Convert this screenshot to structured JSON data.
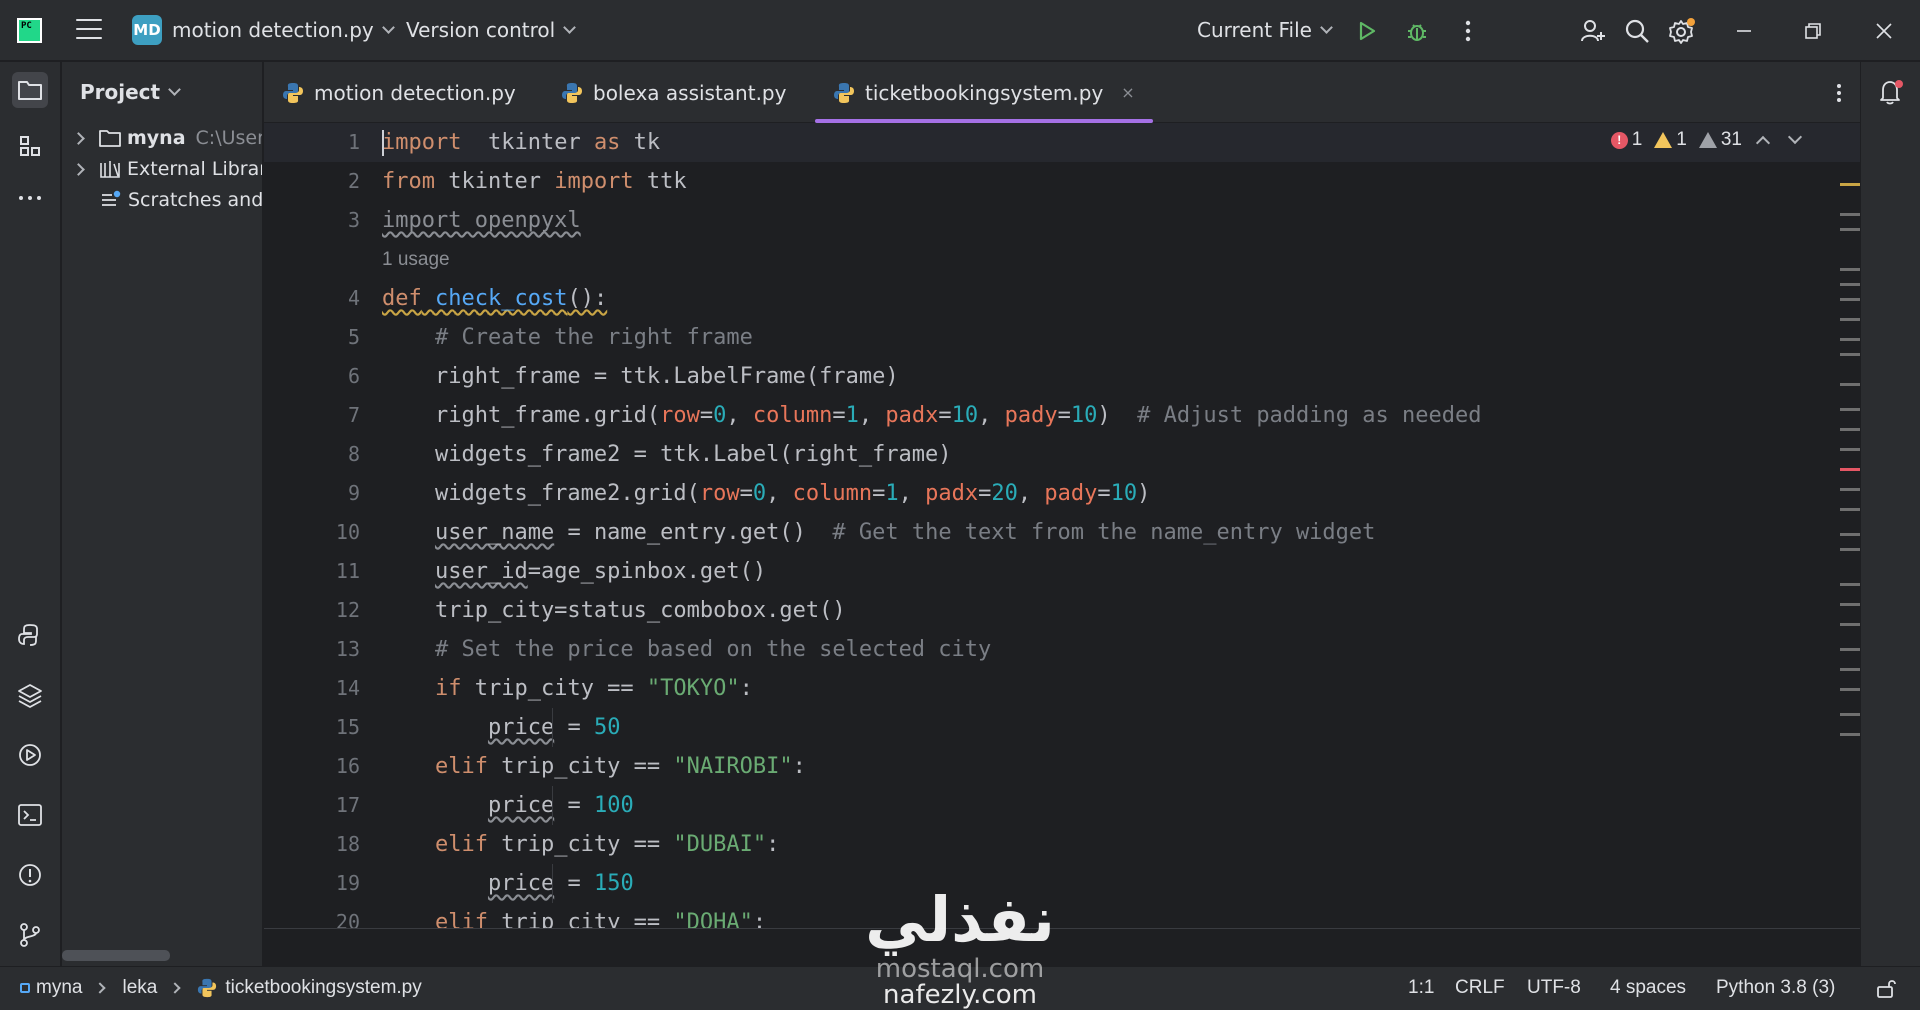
{
  "titlebar": {
    "logo_text": "PC",
    "project_badge": "MD",
    "project_name": "motion detection.py",
    "vcs_label": "Version control",
    "run_config": "Current File"
  },
  "project_panel": {
    "title": "Project",
    "items": [
      {
        "label": "myna",
        "hint": "C:\\Users"
      },
      {
        "label": "External Librari"
      },
      {
        "label": "Scratches and"
      }
    ]
  },
  "tabs": [
    {
      "label": "motion detection.py"
    },
    {
      "label": "bolexa assistant.py"
    },
    {
      "label": "ticketbookingsystem.py",
      "close": "×"
    }
  ],
  "inspections": {
    "errors": "1",
    "warnings": "1",
    "weak_warnings": "31"
  },
  "editor": {
    "usage_hint": "1 usage",
    "lines": [
      {
        "n": "1",
        "parts": [
          [
            "kw",
            "import"
          ],
          [
            "",
            "  tkinter "
          ],
          [
            "kw",
            "as"
          ],
          [
            "",
            " tk"
          ]
        ]
      },
      {
        "n": "2",
        "parts": [
          [
            "kw",
            "from"
          ],
          [
            "",
            " tkinter "
          ],
          [
            "kw",
            "import"
          ],
          [
            "",
            " ttk"
          ]
        ]
      },
      {
        "n": "3",
        "parts": [
          [
            "gray-warn",
            "import openpyxl"
          ]
        ]
      },
      {
        "n": "4",
        "parts": [
          [
            "kw-warny",
            "def"
          ],
          [
            "fn-warny",
            " check_cost"
          ],
          [
            "warny",
            "():"
          ]
        ]
      },
      {
        "n": "5",
        "parts": [
          [
            "",
            "    "
          ],
          [
            "cm",
            "# Create the right frame"
          ]
        ]
      },
      {
        "n": "6",
        "parts": [
          [
            "",
            "    right_frame = ttk.LabelFrame(frame)"
          ]
        ]
      },
      {
        "n": "7",
        "parts": [
          [
            "",
            "    right_frame.grid("
          ],
          [
            "par",
            "row"
          ],
          [
            "",
            "="
          ],
          [
            "num",
            "0"
          ],
          [
            "",
            ", "
          ],
          [
            "par",
            "column"
          ],
          [
            "",
            "="
          ],
          [
            "num",
            "1"
          ],
          [
            "",
            ", "
          ],
          [
            "par",
            "padx"
          ],
          [
            "",
            "="
          ],
          [
            "num",
            "10"
          ],
          [
            "",
            ", "
          ],
          [
            "par",
            "pady"
          ],
          [
            "",
            "="
          ],
          [
            "num",
            "10"
          ],
          [
            "",
            ")  "
          ],
          [
            "cm",
            "# Adjust padding as needed"
          ]
        ]
      },
      {
        "n": "8",
        "parts": [
          [
            "",
            "    widgets_frame2 = ttk.Label(right_frame)"
          ]
        ]
      },
      {
        "n": "9",
        "parts": [
          [
            "",
            "    widgets_frame2.grid("
          ],
          [
            "par",
            "row"
          ],
          [
            "",
            "="
          ],
          [
            "num",
            "0"
          ],
          [
            "",
            ", "
          ],
          [
            "par",
            "column"
          ],
          [
            "",
            "="
          ],
          [
            "num",
            "1"
          ],
          [
            "",
            ", "
          ],
          [
            "par",
            "padx"
          ],
          [
            "",
            "="
          ],
          [
            "num",
            "20"
          ],
          [
            "",
            ", "
          ],
          [
            "par",
            "pady"
          ],
          [
            "",
            "="
          ],
          [
            "num",
            "10"
          ],
          [
            "",
            ")"
          ]
        ]
      },
      {
        "n": "10",
        "parts": [
          [
            "",
            "    "
          ],
          [
            "warn",
            "user_name"
          ],
          [
            "",
            " = name_entry.get()  "
          ],
          [
            "cm",
            "# Get the text from the name_entry widget"
          ]
        ]
      },
      {
        "n": "11",
        "parts": [
          [
            "",
            "    "
          ],
          [
            "warn",
            "user_id"
          ],
          [
            "",
            "=age_spinbox.get()"
          ]
        ]
      },
      {
        "n": "12",
        "parts": [
          [
            "",
            "    trip_city=status_combobox.get()"
          ]
        ]
      },
      {
        "n": "13",
        "parts": [
          [
            "",
            "    "
          ],
          [
            "cm",
            "# Set the price based on the selected city"
          ]
        ]
      },
      {
        "n": "14",
        "parts": [
          [
            "",
            "    "
          ],
          [
            "kw",
            "if"
          ],
          [
            "",
            " trip_city == "
          ],
          [
            "str",
            "\"TOKYO\""
          ],
          [
            "",
            ":"
          ]
        ]
      },
      {
        "n": "15",
        "parts": [
          [
            "",
            "        "
          ],
          [
            "warn",
            "price"
          ],
          [
            "",
            " = "
          ],
          [
            "num",
            "50"
          ]
        ]
      },
      {
        "n": "16",
        "parts": [
          [
            "",
            "    "
          ],
          [
            "kw",
            "elif"
          ],
          [
            "",
            " trip_city == "
          ],
          [
            "str",
            "\"NAIROBI\""
          ],
          [
            "",
            ":"
          ]
        ]
      },
      {
        "n": "17",
        "parts": [
          [
            "",
            "        "
          ],
          [
            "warn",
            "price"
          ],
          [
            "",
            " = "
          ],
          [
            "num",
            "100"
          ]
        ]
      },
      {
        "n": "18",
        "parts": [
          [
            "",
            "    "
          ],
          [
            "kw",
            "elif"
          ],
          [
            "",
            " trip_city == "
          ],
          [
            "str",
            "\"DUBAI\""
          ],
          [
            "",
            ":"
          ]
        ]
      },
      {
        "n": "19",
        "parts": [
          [
            "",
            "        "
          ],
          [
            "warn",
            "price"
          ],
          [
            "",
            " = "
          ],
          [
            "num",
            "150"
          ]
        ]
      },
      {
        "n": "20",
        "parts": [
          [
            "",
            "    "
          ],
          [
            "kw",
            "elif"
          ],
          [
            "",
            " trip_city == "
          ],
          [
            "str",
            "\"DOHA\""
          ],
          [
            "",
            ":"
          ]
        ]
      }
    ]
  },
  "statusbar": {
    "crumbs": [
      "myna",
      "leka",
      "ticketbookingsystem.py"
    ],
    "position": "1:1",
    "line_sep": "CRLF",
    "encoding": "UTF-8",
    "indent": "4 spaces",
    "interpreter": "Python 3.8 (3)"
  },
  "watermark": {
    "arabic": "نفذلي",
    "latin": "mostaql.com",
    "latin2": "nafezly.com"
  },
  "colors": {
    "accent": "#a571e6",
    "keyword": "#cf8e6d",
    "function": "#56a8f5",
    "string": "#6aab73",
    "number": "#2aacb8",
    "param": "#e8765a",
    "comment": "#7a7e85"
  }
}
